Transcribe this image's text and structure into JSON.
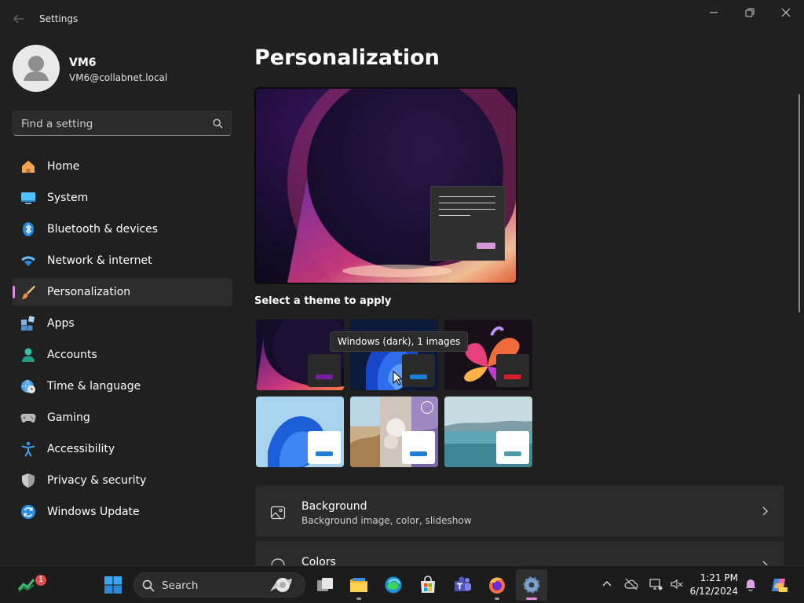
{
  "window": {
    "title": "Settings",
    "controls": {
      "minimize": "minimize-icon",
      "maximize": "restore-icon",
      "close": "close-icon"
    }
  },
  "profile": {
    "name": "VM6",
    "email": "VM6@collabnet.local"
  },
  "search": {
    "placeholder": "Find a setting"
  },
  "nav": [
    {
      "label": "Home",
      "icon": "home-icon"
    },
    {
      "label": "System",
      "icon": "monitor-icon"
    },
    {
      "label": "Bluetooth & devices",
      "icon": "bluetooth-icon"
    },
    {
      "label": "Network & internet",
      "icon": "wifi-icon"
    },
    {
      "label": "Personalization",
      "icon": "brush-icon",
      "active": true
    },
    {
      "label": "Apps",
      "icon": "apps-icon"
    },
    {
      "label": "Accounts",
      "icon": "person-icon"
    },
    {
      "label": "Time & language",
      "icon": "clock-globe-icon"
    },
    {
      "label": "Gaming",
      "icon": "gamepad-icon"
    },
    {
      "label": "Accessibility",
      "icon": "accessibility-icon"
    },
    {
      "label": "Privacy & security",
      "icon": "shield-icon"
    },
    {
      "label": "Windows Update",
      "icon": "update-icon"
    }
  ],
  "main": {
    "title": "Personalization",
    "themes_label": "Select a theme to apply",
    "tooltip": "Windows (dark), 1 images",
    "themes": [
      {
        "name": "glow-dark",
        "accent": "#7a1ea0",
        "tile": "#2a2a2a"
      },
      {
        "name": "windows-dark",
        "accent": "#1e7fd6",
        "tile": "#2a2a2a"
      },
      {
        "name": "flower-dark",
        "accent": "#d81e2a",
        "tile": "#2a2a2a"
      },
      {
        "name": "windows-light",
        "accent": "#1e7fd6",
        "tile": "#ffffff"
      },
      {
        "name": "spotlight",
        "accent": "#1e7fd6",
        "tile": "#ffffff"
      },
      {
        "name": "lake-light",
        "accent": "#4a9aa8",
        "tile": "#ffffff"
      }
    ],
    "cards": [
      {
        "title": "Background",
        "subtitle": "Background image, color, slideshow",
        "icon": "image-icon"
      },
      {
        "title": "Colors",
        "subtitle": "",
        "icon": "palette-icon"
      }
    ]
  },
  "taskbar": {
    "search_label": "Search",
    "notification_count": "1",
    "time": "1:21 PM",
    "date": "6/12/2024",
    "apps": [
      "widgets-icon",
      "start-icon",
      "task-view-icon",
      "file-explorer-icon",
      "edge-icon",
      "store-icon",
      "teams-icon",
      "firefox-icon",
      "settings-icon"
    ]
  }
}
